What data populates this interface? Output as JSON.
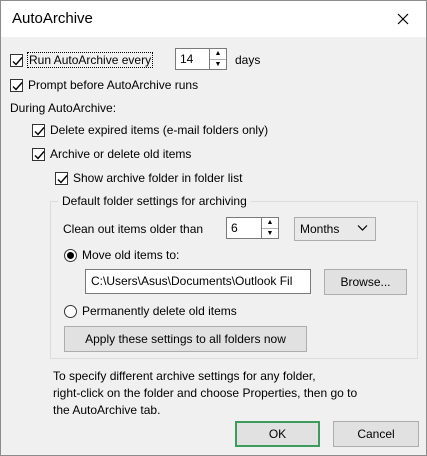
{
  "window": {
    "title": "AutoArchive"
  },
  "run_every": {
    "label": "Run AutoArchive every",
    "value": "14",
    "unit": "days",
    "checked": true
  },
  "prompt_before": {
    "label": "Prompt before AutoArchive runs",
    "checked": true
  },
  "during_label": "During AutoArchive:",
  "delete_expired": {
    "label": "Delete expired items (e-mail folders only)",
    "checked": true
  },
  "archive_old": {
    "label": "Archive or delete old items",
    "checked": true
  },
  "show_folder": {
    "label": "Show archive folder in folder list",
    "checked": true
  },
  "defaults": {
    "title": "Default folder settings for archiving",
    "clean_label": "Clean out items older than",
    "clean_value": "6",
    "clean_unit": "Months",
    "move_label": "Move old items to:",
    "move_selected": true,
    "path": "C:\\Users\\Asus\\Documents\\Outlook Fil",
    "browse_label": "Browse...",
    "perm_delete_label": "Permanently delete old items",
    "apply_label": "Apply these settings to all folders now"
  },
  "info_lines": [
    "To specify different archive settings for any folder,",
    "right-click on the folder and choose Properties, then go to",
    "the AutoArchive tab."
  ],
  "buttons": {
    "ok": "OK",
    "cancel": "Cancel"
  },
  "colors": {
    "default_button_border": "#3c9c5c"
  }
}
